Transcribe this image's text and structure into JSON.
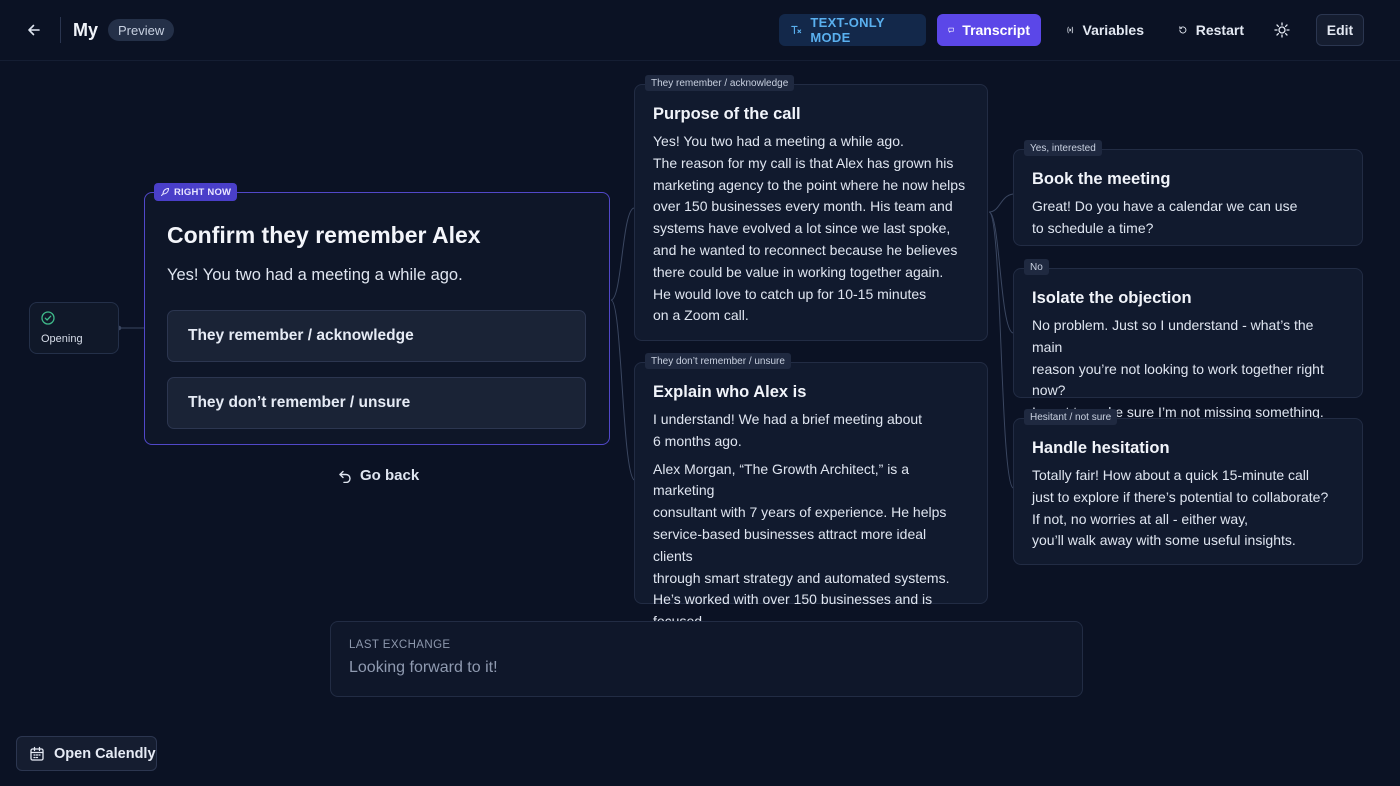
{
  "header": {
    "title": "My",
    "badge": "Preview",
    "text_only_mode": "TEXT-ONLY MODE",
    "transcript": "Transcript",
    "variables": "Variables",
    "restart": "Restart",
    "edit": "Edit"
  },
  "opening": {
    "label": "Opening"
  },
  "current_step": {
    "badge": "RIGHT NOW",
    "title": "Confirm they remember Alex",
    "line": "Yes! You two had a meeting a while ago.",
    "options": [
      "They remember / acknowledge",
      "They don’t remember / unsure"
    ],
    "go_back": "Go back"
  },
  "next_steps": [
    {
      "tag": "They remember / acknowledge",
      "title": "Purpose of the call",
      "body": "Yes! You two had a meeting a while ago.\nThe reason for my call is that Alex has grown his\nmarketing agency to the point where he now helps\nover 150 businesses every month. His team and\nsystems have evolved a lot since we last spoke,\nand he wanted to reconnect because he believes\nthere could be value in working together again.\nHe would love to catch up for 10-15 minutes\non a Zoom call."
    },
    {
      "tag": "They don’t remember / unsure",
      "title": "Explain who Alex is",
      "body": "I understand! We had a brief meeting about\n6 months ago.",
      "body2": "Alex Morgan, “The Growth Architect,” is a marketing\nconsultant with 7 years of experience. He helps\nservice-based businesses attract more ideal clients\nthrough smart strategy and automated systems.\nHe’s worked with over 150 businesses and is focused\non long-term partnerships, not just quick wins."
    }
  ],
  "followups": [
    {
      "tag": "Yes, interested",
      "title": "Book the meeting",
      "body": "Great! Do you have a calendar we can use\nto schedule a time?"
    },
    {
      "tag": "No",
      "title": "Isolate the objection",
      "body": "No problem. Just so I understand - what’s the main\nreason you’re not looking to work together right now?\nI want to make sure I’m not missing something."
    },
    {
      "tag": "Hesitant / not sure",
      "title": "Handle hesitation",
      "body": "Totally fair! How about a quick 15-minute call\njust to explore if there’s potential to collaborate?\nIf not, no worries at all - either way,\nyou’ll walk away with some useful insights."
    }
  ],
  "last_exchange": {
    "label": "LAST EXCHANGE",
    "text": "Looking forward to it!"
  },
  "calendly": {
    "label": "Open Calendly"
  },
  "colors": {
    "background": "#0b1224",
    "accent": "#5b47e8",
    "text_only_mode": "#5ab0ef",
    "active_border": "#5148c9",
    "success": "#3fb98a"
  }
}
